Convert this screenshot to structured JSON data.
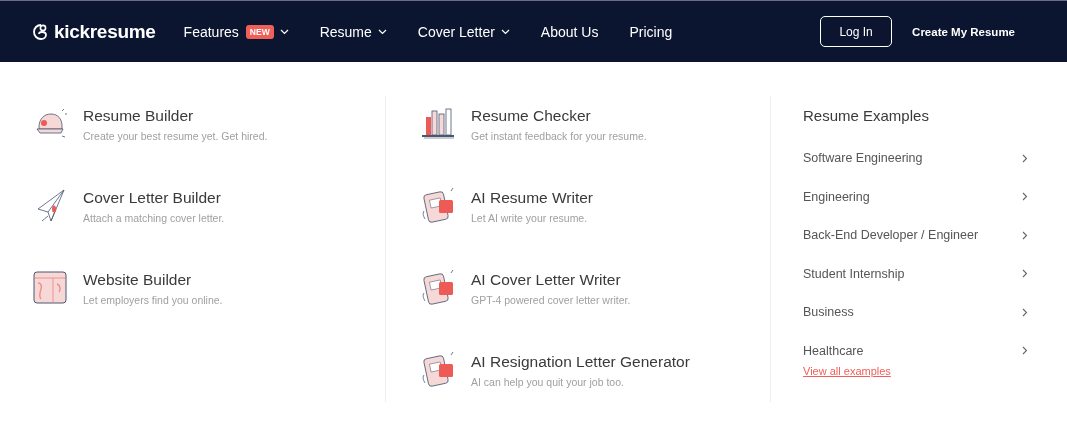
{
  "nav": {
    "logo": "kickresume",
    "items": [
      {
        "label": "Features",
        "badge": "NEW",
        "dropdown": true
      },
      {
        "label": "Resume",
        "dropdown": true
      },
      {
        "label": "Cover Letter",
        "dropdown": true
      },
      {
        "label": "About Us",
        "dropdown": false
      },
      {
        "label": "Pricing",
        "dropdown": false
      }
    ],
    "login": "Log In",
    "cta": "Create My Resume"
  },
  "columns": [
    {
      "items": [
        {
          "title": "Resume Builder",
          "description": "Create your best resume yet. Get hired."
        },
        {
          "title": "Cover Letter Builder",
          "description": "Attach a matching cover letter."
        },
        {
          "title": "Website Builder",
          "description": "Let employers find you online."
        }
      ]
    },
    {
      "items": [
        {
          "title": "Resume Checker",
          "description": "Get instant feedback for your resume."
        },
        {
          "title": "AI Resume Writer",
          "description": "Let AI write your resume."
        },
        {
          "title": "AI Cover Letter Writer",
          "description": "GPT-4 powered cover letter writer."
        },
        {
          "title": "AI Resignation Letter Generator",
          "description": "AI can help you quit your job too."
        }
      ]
    }
  ],
  "examples": {
    "title": "Resume Examples",
    "items": [
      "Software Engineering",
      "Engineering",
      "Back-End Developer / Engineer",
      "Student Internship",
      "Business",
      "Healthcare"
    ],
    "link": "View all examples"
  }
}
